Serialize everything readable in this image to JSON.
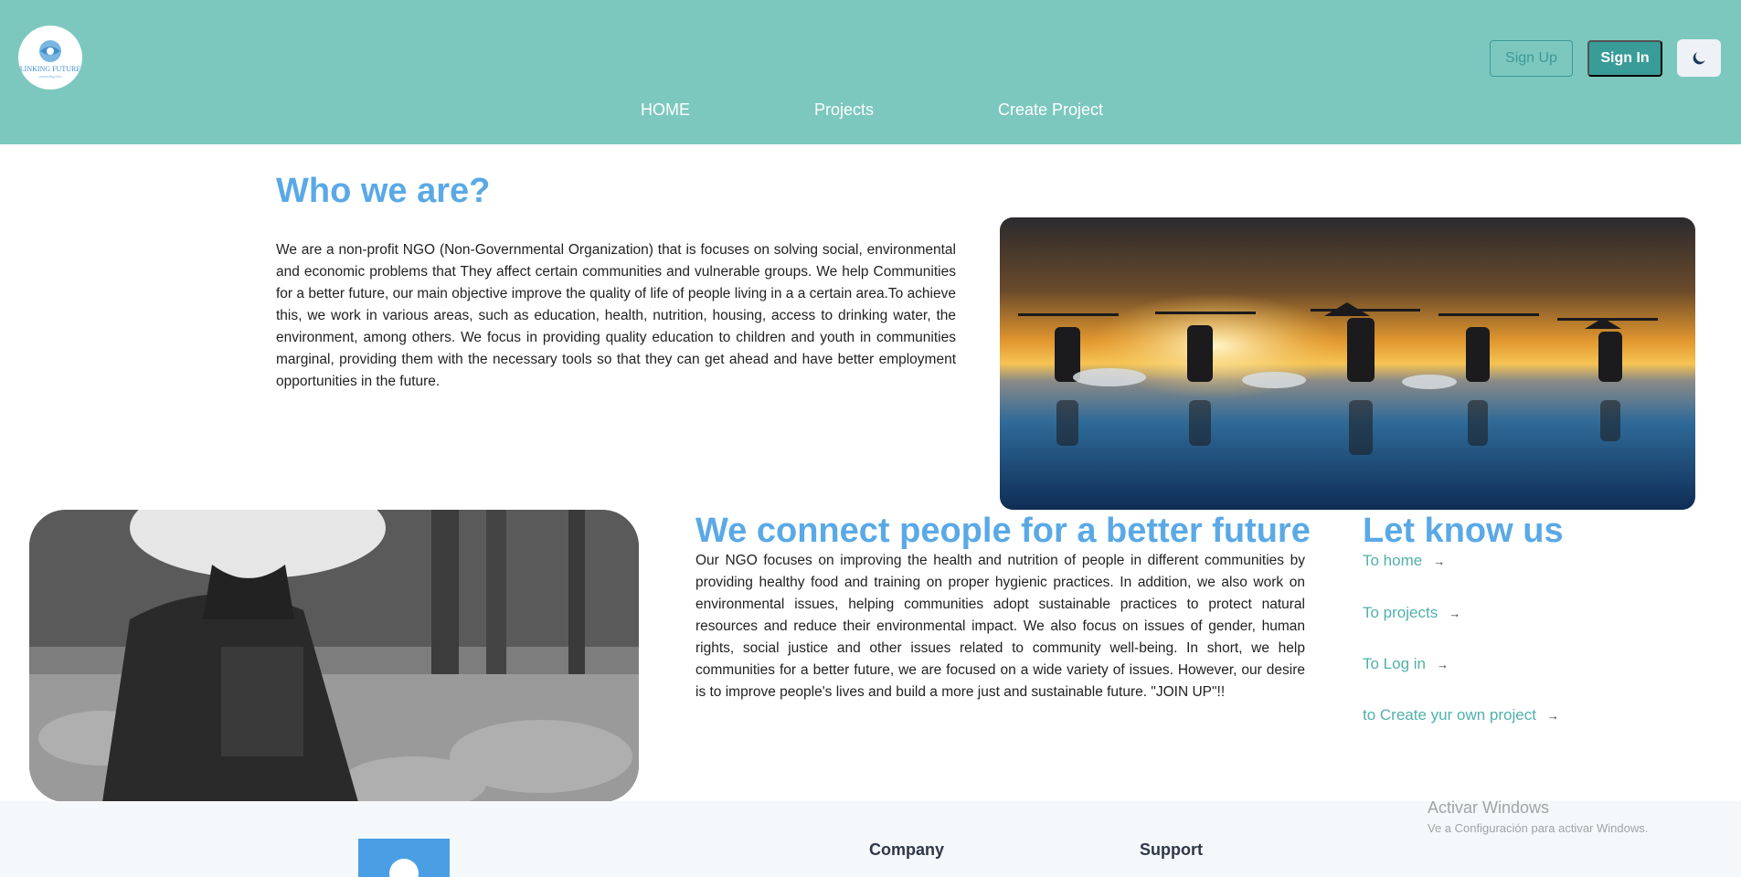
{
  "header": {
    "logo_text": "LINKING FUTURE",
    "logo_tagline": "connecting lives",
    "nav": [
      "HOME",
      "Projects",
      "Create Project"
    ],
    "signup_label": "Sign Up",
    "signin_label": "Sign In",
    "theme_icon": "moon-icon"
  },
  "who": {
    "title": "Who we are?",
    "body": "We are a non-profit NGO (Non-Governmental Organization) that is focuses on solving social, environmental and economic problems that They affect certain communities and vulnerable groups. We help Communities for a better future, our main objective improve the quality of life of people living in a a certain area.To achieve this, we work in various areas, such as education, health, nutrition, housing, access to drinking water, the environment, among others. We focus in providing quality education to children and youth in communities marginal, providing them with the necessary tools so that they can get ahead and have better employment opportunities in the future."
  },
  "connect": {
    "title": "We connect people for a better future",
    "body": "Our NGO focuses on improving the health and nutrition of people in different communities by providing healthy food and training on proper hygienic practices. In addition, we also work on environmental issues, helping communities adopt sustainable practices to protect natural resources and reduce their environmental impact. We also focus on issues of gender, human rights, social justice and other issues related to community well-being. In short, we help communities for a better future, we are focused on a wide variety of issues. However, our desire is to improve people's lives and build a more just and sustainable future. \"JOIN UP\"!!"
  },
  "know": {
    "title": "Let know us",
    "links": [
      "To home",
      "To projects",
      "To Log in",
      "to Create yur own project"
    ],
    "arrow": "→"
  },
  "footer": {
    "company": "Company",
    "support": "Support"
  },
  "watermark": {
    "title": "Activar Windows",
    "subtitle": "Ve a Configuración para activar Windows."
  },
  "colors": {
    "header_bg": "#7cc8bf",
    "heading_blue": "#5aa9e6",
    "link_teal": "#4fb0ab",
    "button_teal": "#3a9c98"
  }
}
